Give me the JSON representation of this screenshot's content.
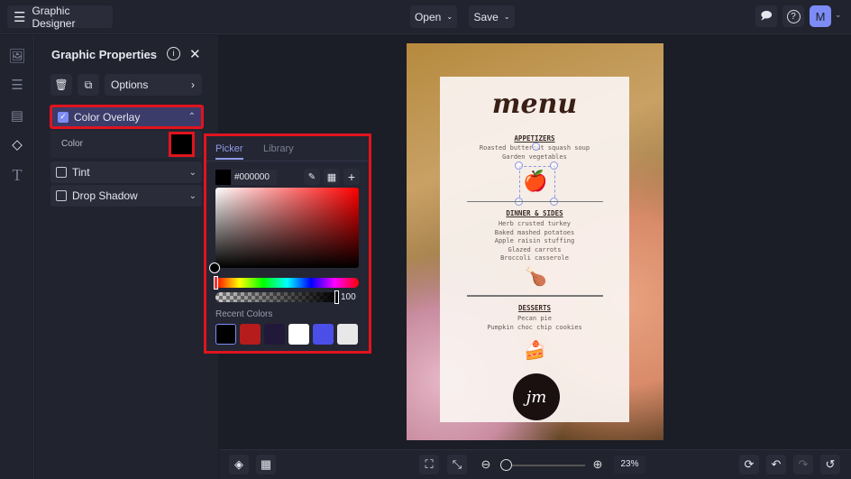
{
  "app": {
    "title": "Graphic Designer",
    "open_label": "Open",
    "save_label": "Save",
    "avatar_initial": "M",
    "accent": "#7d8cf5"
  },
  "rail": {
    "items": [
      "image-icon",
      "sliders-icon",
      "layout-icon",
      "shapes-icon",
      "text-icon"
    ]
  },
  "panel": {
    "title": "Graphic Properties",
    "options_label": "Options",
    "sections": [
      {
        "label": "Color Overlay",
        "checked": true,
        "expanded": true
      },
      {
        "label": "Tint",
        "checked": false
      },
      {
        "label": "Drop Shadow",
        "checked": false
      }
    ],
    "color_label": "Color",
    "color_value": "#000000"
  },
  "picker": {
    "tabs": [
      "Picker",
      "Library"
    ],
    "active_tab": "Picker",
    "hex": "#000000",
    "opacity": "100",
    "recent_label": "Recent Colors",
    "recent_colors": [
      "#000000",
      "#b71c1c",
      "#22183a",
      "#ffffff",
      "#4b4fe8",
      "#e8e8e8"
    ]
  },
  "canvas": {
    "menu_title": "menu",
    "sections": [
      {
        "heading": "APPETIZERS",
        "items": [
          "Roasted butternut squash soup",
          "Garden vegetables"
        ]
      },
      {
        "heading": "DINNER & SIDES",
        "items": [
          "Herb crusted turkey",
          "Baked mashed potatoes",
          "Apple raisin stuffing",
          "Glazed carrots",
          "Broccoli casserole"
        ]
      },
      {
        "heading": "DESSERTS",
        "items": [
          "Pecan pie",
          "Pumpkin choc chip cookies"
        ]
      }
    ],
    "logo_text": "jm"
  },
  "bottom": {
    "zoom": "23%",
    "zoom_fraction": 0.05
  }
}
